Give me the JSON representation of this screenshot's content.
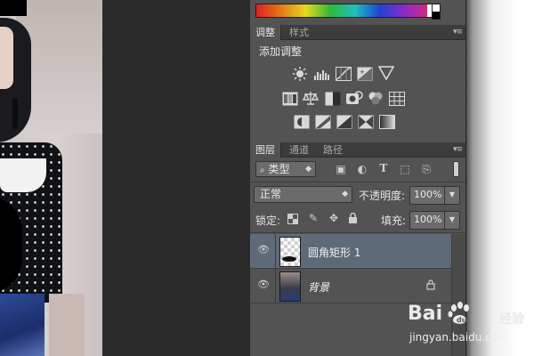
{
  "adjustments_panel": {
    "tabs": [
      {
        "label": "调整",
        "active": true
      },
      {
        "label": "样式",
        "active": false
      }
    ],
    "title": "添加调整",
    "icons": [
      [
        "brightness-contrast-icon",
        "levels-icon",
        "curves-icon",
        "exposure-icon",
        "vibrance-icon"
      ],
      [
        "hue-saturation-icon",
        "color-balance-icon",
        "black-white-icon",
        "photo-filter-icon",
        "channel-mixer-icon",
        "color-lookup-icon"
      ],
      [
        "invert-icon",
        "posterize-icon",
        "threshold-icon",
        "selective-color-icon",
        "gradient-map-icon"
      ]
    ]
  },
  "layers_panel": {
    "tabs": [
      {
        "label": "图层",
        "active": true
      },
      {
        "label": "通道",
        "active": false
      },
      {
        "label": "路径",
        "active": false
      }
    ],
    "filter_kind": "类型",
    "blend_mode": "正常",
    "opacity_label": "不透明度:",
    "opacity_value": "100%",
    "lock_label": "锁定:",
    "fill_label": "填充:",
    "fill_value": "100%",
    "layers": [
      {
        "name": "圆角矩形 1",
        "selected": true,
        "visible": true,
        "locked": false
      },
      {
        "name": "背景",
        "selected": false,
        "visible": true,
        "locked": true
      }
    ]
  },
  "watermark": {
    "brand": "Bai",
    "brand_suffix": "经验",
    "url": "jingyan.baidu.com"
  },
  "colors": {
    "panel_bg": "#535353",
    "tab_bar_bg": "#3c3c3c",
    "selected_layer": "#5f6a79",
    "gutter": "#2b2b2b"
  }
}
